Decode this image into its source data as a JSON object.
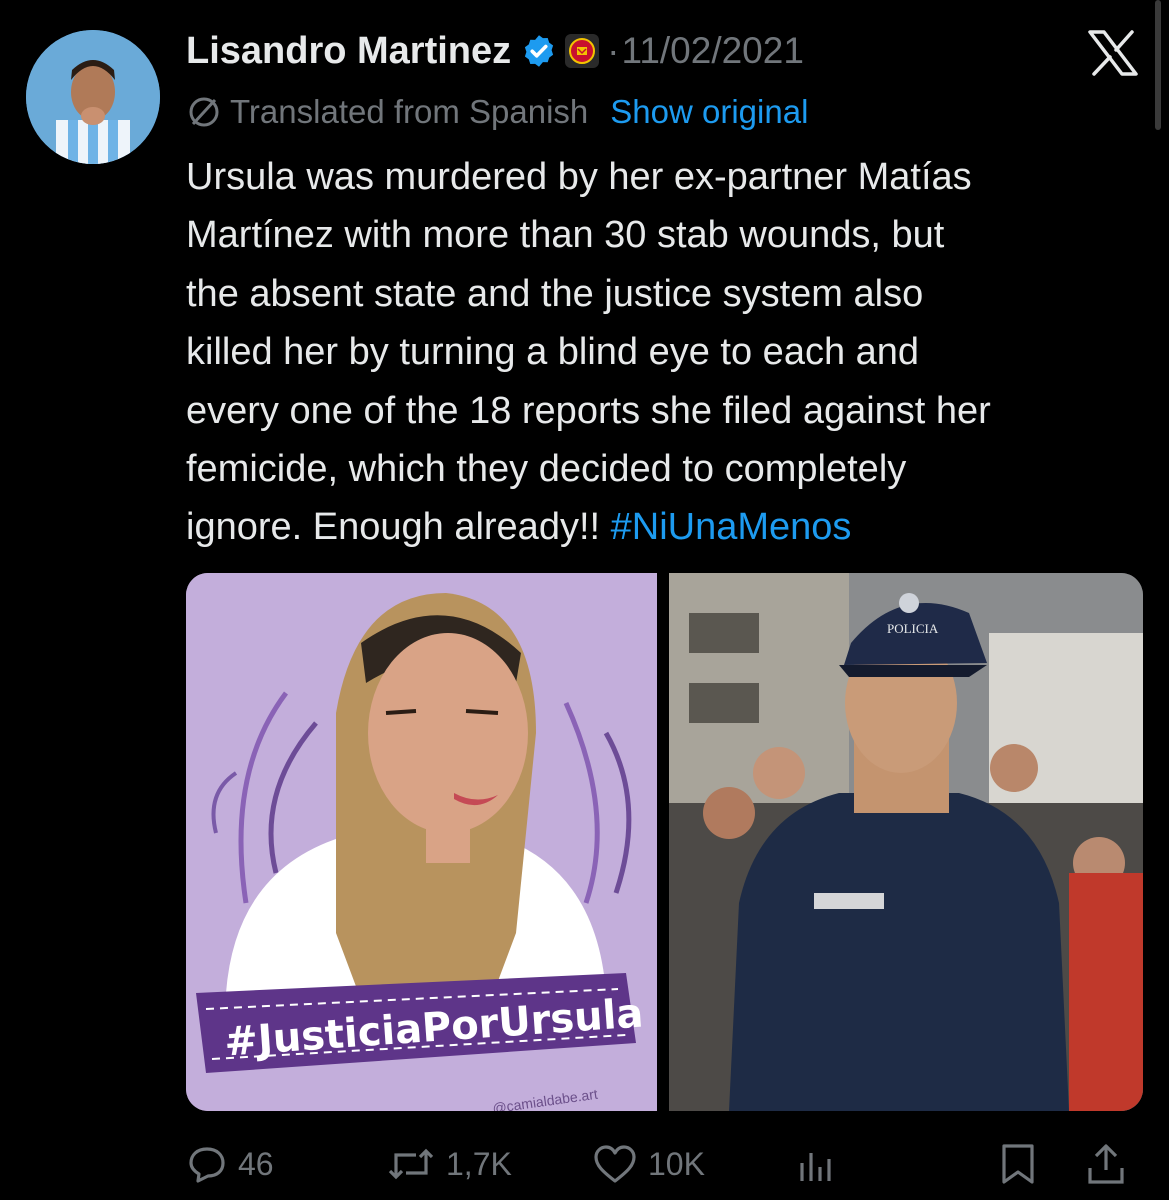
{
  "tweet": {
    "author_name": "Lisandro Martinez",
    "date_separator": "·",
    "date": "11/02/2021",
    "translation_note": "Translated from Spanish",
    "show_original_label": "Show original",
    "text_line1": "Ursula was murdered by her ex-partner Matías",
    "text_line2": "Martínez with more than 30 stab wounds, but",
    "text_line3": "the absent state and the justice system also",
    "text_line4": "killed her by turning a blind eye to each and",
    "text_line5": "every one of the 18 reports she filed against her",
    "text_line6": "femicide, which they decided to completely",
    "text_line7_prefix": "ignore. Enough already!! ",
    "hashtag": "#NiUnaMenos",
    "media": {
      "left_banner_text": "#JusticiaPorUrsula",
      "left_credit": "@camialdabe.art",
      "right_cap_text": "POLICIA"
    },
    "actions": {
      "replies": "46",
      "reposts": "1,7K",
      "likes": "10K"
    }
  },
  "colors": {
    "background": "#000000",
    "text_primary": "#e7e9ea",
    "text_secondary": "#71767b",
    "link_blue": "#1d9bf0",
    "verified_blue": "#1d9bf0",
    "illustration_purple": "#c3aedb"
  },
  "icons": [
    "verified-badge-icon",
    "manchester-united-badge-icon",
    "x-close-icon",
    "translate-icon",
    "reply-icon",
    "repost-icon",
    "like-icon",
    "views-icon",
    "bookmark-icon",
    "share-icon"
  ]
}
